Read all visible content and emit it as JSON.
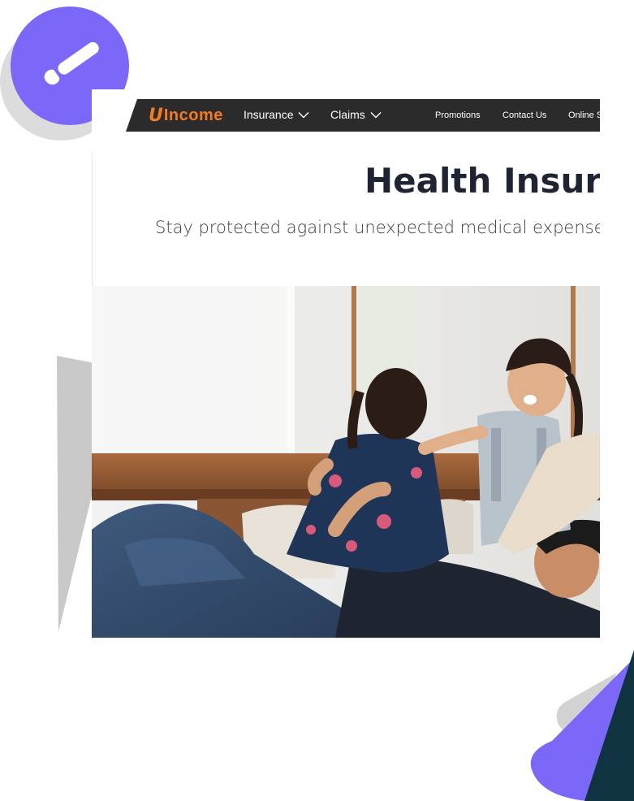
{
  "colors": {
    "accent": "#7b67f8",
    "brand_orange": "#f47c20",
    "nav_bg": "#2b2b2b",
    "heading": "#1f2433",
    "deco_dark": "#0f3340"
  },
  "icons": {
    "badge": "paintbrush-icon",
    "dropdown": "chevron-down-icon"
  },
  "nav": {
    "logo_text": "Income",
    "logo_mark": "U",
    "items": [
      {
        "label": "Insurance"
      },
      {
        "label": "Claims"
      }
    ],
    "links": [
      {
        "label": "Promotions"
      },
      {
        "label": "Contact Us"
      },
      {
        "label": "Online S"
      }
    ]
  },
  "hero": {
    "title": "Health Insura",
    "subtitle": "Stay protected against unexpected medical expenses"
  }
}
